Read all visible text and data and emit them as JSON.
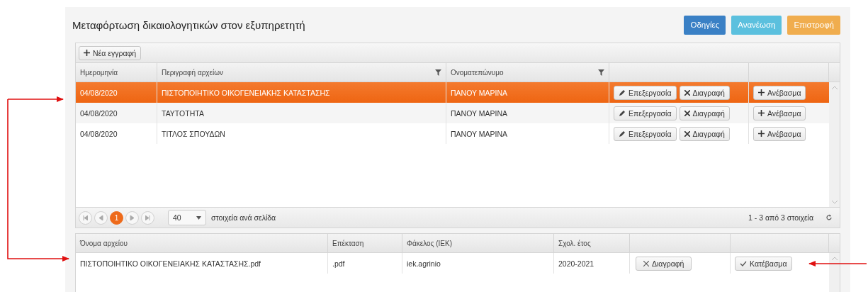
{
  "page": {
    "title": "Μεταφόρτωση δικαιολογητικών στον εξυπηρετητή"
  },
  "header_buttons": [
    {
      "label": "Οδηγίες",
      "kind": "primary"
    },
    {
      "label": "Ανανέωση",
      "kind": "info"
    },
    {
      "label": "Επιστροφή",
      "kind": "warning"
    }
  ],
  "documents_grid": {
    "toolbar_button": "Νέα εγγραφή",
    "columns": [
      {
        "label": "Ημερομηνία",
        "filter": false
      },
      {
        "label": "Περιγραφή αρχείων",
        "filter": true
      },
      {
        "label": "Ονοματεπώνυμο",
        "filter": true
      }
    ],
    "rows": [
      {
        "date": "04/08/2020",
        "description": "ΠΙΣΤΟΠΟΙΗΤΙΚΟ ΟΙΚΟΓΕΝΕΙΑΚΗΣ ΚΑΤΑΣΤΑΣΗΣ",
        "name": "ΠΑΝΟΥ ΜΑΡΙΝΑ",
        "selected": true,
        "edit_label": "Επεξεργασία",
        "delete_label": "Διαγραφή",
        "upload_label": "Ανέβασμα"
      },
      {
        "date": "04/08/2020",
        "description": "ΤΑΥΤΟΤΗΤΑ",
        "name": "ΠΑΝΟΥ ΜΑΡΙΝΑ",
        "selected": false,
        "edit_label": "Επεξεργασία",
        "delete_label": "Διαγραφή",
        "upload_label": "Ανέβασμα"
      },
      {
        "date": "04/08/2020",
        "description": "ΤΙΤΛΟΣ ΣΠΟΥΔΩΝ",
        "name": "ΠΑΝΟΥ ΜΑΡΙΝΑ",
        "selected": false,
        "edit_label": "Επεξεργασία",
        "delete_label": "Διαγραφή",
        "upload_label": "Ανέβασμα"
      }
    ],
    "pager": {
      "pages": [
        {
          "label": "1",
          "selected": true
        }
      ],
      "page_size": "40",
      "page_size_label": "στοιχεία ανά σελίδα",
      "summary": "1 - 3 από 3 στοιχεία"
    }
  },
  "files_grid": {
    "columns": [
      "Όνομα αρχείου",
      "Επέκταση",
      "Φάκελος (IEK)",
      "Σχολ. έτος"
    ],
    "rows": [
      {
        "file_name": "ΠΙΣΤΟΠΟΙΗΤΙΚΟ ΟΙΚΟΓΕΝΕΙΑΚΗΣ ΚΑΤΑΣΤΑΣΗΣ.pdf",
        "extension": ".pdf",
        "folder": "iek.agrinio",
        "school_year": "2020-2021",
        "delete_label": "Διαγραφή",
        "download_label": "Κατέβασμα"
      }
    ]
  }
}
